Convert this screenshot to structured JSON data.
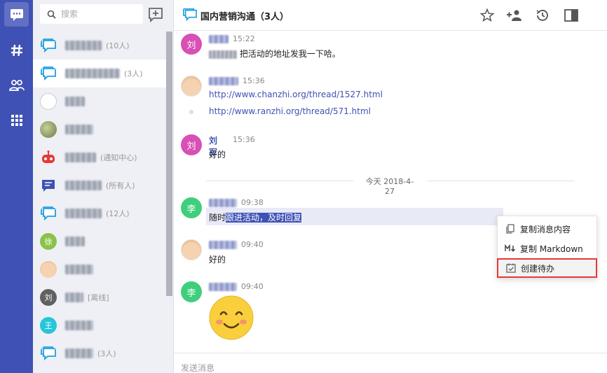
{
  "search": {
    "placeholder": "搜索"
  },
  "conversations": [
    {
      "avatar_text": "",
      "sub": "(10人)"
    },
    {
      "avatar_text": "",
      "sub": "(3人)"
    },
    {
      "avatar_text": "",
      "sub": ""
    },
    {
      "avatar_text": "",
      "sub": ""
    },
    {
      "avatar_text": "",
      "sub": "(通知中心)"
    },
    {
      "avatar_text": "",
      "sub": "(所有人)"
    },
    {
      "avatar_text": "",
      "sub": "(12人)"
    },
    {
      "avatar_text": "徐",
      "sub": ""
    },
    {
      "avatar_text": "",
      "sub": ""
    },
    {
      "avatar_text": "刘",
      "sub": "[离线]"
    },
    {
      "avatar_text": "王",
      "sub": ""
    },
    {
      "avatar_text": "",
      "sub": "(3人)"
    }
  ],
  "header": {
    "title": "国内营销沟通（3人）"
  },
  "messages": {
    "m1": {
      "avatar": "刘",
      "time": "15:22",
      "text": "把活动的地址发我一下哈。"
    },
    "m2": {
      "time": "15:36",
      "link1": "http://www.chanzhi.org/thread/1527.html",
      "link2": "http://www.ranzhi.org/thread/571.html"
    },
    "m3": {
      "avatar": "刘",
      "sender": "刘军",
      "time": "15:36",
      "text": "好的"
    },
    "divider": "今天 2018-4-27",
    "m4": {
      "avatar": "李",
      "time": "09:38",
      "text_pre": "随时",
      "text_sel": "跟进活动，及时回复"
    },
    "m5": {
      "time": "09:40",
      "text": "好的"
    },
    "m6": {
      "avatar": "李",
      "time": "09:40"
    }
  },
  "context_menu": {
    "copy_content": "复制消息内容",
    "copy_markdown": "复制 Markdown",
    "create_todo": "创建待办"
  },
  "compose": {
    "placeholder": "发送消息"
  },
  "colors": {
    "primary": "#3f51b5",
    "highlight_border": "#e53935"
  }
}
